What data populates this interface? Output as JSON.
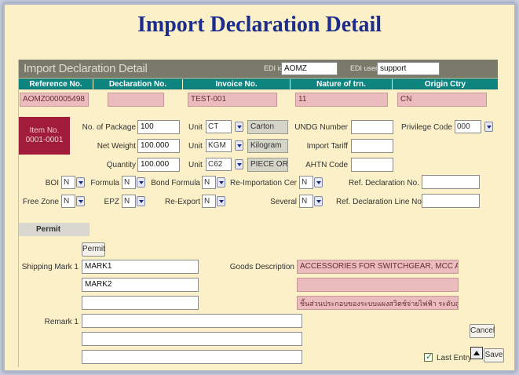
{
  "page_title": "Import Declaration Detail",
  "form": {
    "title": "Import Declaration Detail",
    "edi_id_label": "EDI id",
    "edi_id_value": "AOMZ",
    "edi_user_label": "EDI user",
    "edi_user_value": "support"
  },
  "header_columns": [
    "Reference No.",
    "Declaration No.",
    "Invoice No.",
    "Nature of trn.",
    "Origin Ctry"
  ],
  "header_values": {
    "reference_no": "AOMZ000005498",
    "declaration_no": "",
    "invoice_no": "TEST-001",
    "nature_of_trn": "11",
    "origin_ctry": "CN"
  },
  "item": {
    "item_no_label": "Item No.",
    "item_no_value": "0001-0001",
    "no_of_package_label": "No. of Package",
    "no_of_package_value": "100",
    "net_weight_label": "Net Weight",
    "net_weight_value": "100.000",
    "quantity_label": "Quantity",
    "quantity_value": "100.000",
    "unit_label": "Unit",
    "unit1_code": "CT",
    "unit1_desc": "Carton",
    "unit2_code": "KGM",
    "unit2_desc": "Kilogram",
    "unit3_code": "C62",
    "unit3_desc": "PIECE OR UN",
    "undg_label": "UNDG Number",
    "undg_value": "",
    "import_tariff_label": "Import Tariff",
    "import_tariff_value": "",
    "ahtn_label": "AHTN Code",
    "ahtn_value": "",
    "privilege_label": "Privilege Code",
    "privilege_value": "000"
  },
  "flags": {
    "boi_label": "BOI",
    "boi_value": "N",
    "formula_label": "Formula",
    "formula_value": "N",
    "bond_formula_label": "Bond Formula",
    "bond_formula_value": "N",
    "reimport_label": "Re-Importation Cer",
    "reimport_value": "N",
    "ref_decl_label": "Ref. Declaration No.",
    "ref_decl_value": "",
    "free_zone_label": "Free Zone",
    "free_zone_value": "N",
    "epz_label": "EPZ",
    "epz_value": "N",
    "reexport_label": "Re-Export",
    "reexport_value": "N",
    "several_label": "Several",
    "several_value": "N",
    "ref_decl_line_label": "Ref. Declaration Line No.",
    "ref_decl_line_value": ""
  },
  "permit": {
    "section_label": "Permit",
    "button_label": "Permit"
  },
  "shipping": {
    "mark_label": "Shipping Mark 1",
    "mark1": "MARK1",
    "mark2": "MARK2",
    "mark3": ""
  },
  "goods": {
    "label": "Goods Description",
    "line1": "ACCESSORIES FOR SWITCHGEAR, MCC AND SUS S'",
    "line2": "",
    "line3": "ชิ้นส่วนประกอบของระบบแผงสวิตช์จ่ายไฟฟ้า ระดับสูง ต่ำ สำหรับแ"
  },
  "remark": {
    "label": "Remark 1",
    "line1": "",
    "line2": "",
    "line3": ""
  },
  "actions": {
    "cancel_label": "Cancel",
    "save_label": "Save",
    "last_entry_label": "Last Entry"
  },
  "colors": {
    "title": "#1c2d8c",
    "header_bar": "#0f8580",
    "item_box": "#a01c3a",
    "readonly_field": "#ebbcbe",
    "background": "#fbf0c8"
  }
}
